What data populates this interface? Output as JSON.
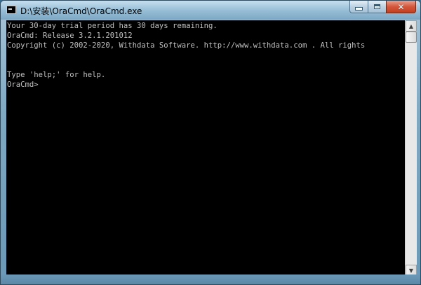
{
  "window": {
    "title": "D:\\安装\\OraCmd\\OraCmd.exe",
    "icon": "console-app-icon"
  },
  "caption_buttons": {
    "minimize": "minimize-icon",
    "maximize": "maximize-icon",
    "close": "✕"
  },
  "console": {
    "lines": [
      "Your 30-day trial period has 30 days remaining.",
      "OraCmd: Release 3.2.1.201012",
      "Copyright (c) 2002-2020, Withdata Software. http://www.withdata.com . All rights",
      "",
      "",
      "Type 'help;' for help.",
      "OraCmd>"
    ],
    "background": "#000000",
    "foreground": "#c0c0c0"
  },
  "scrollbar": {
    "up_arrow": "▲",
    "down_arrow": "▼"
  }
}
